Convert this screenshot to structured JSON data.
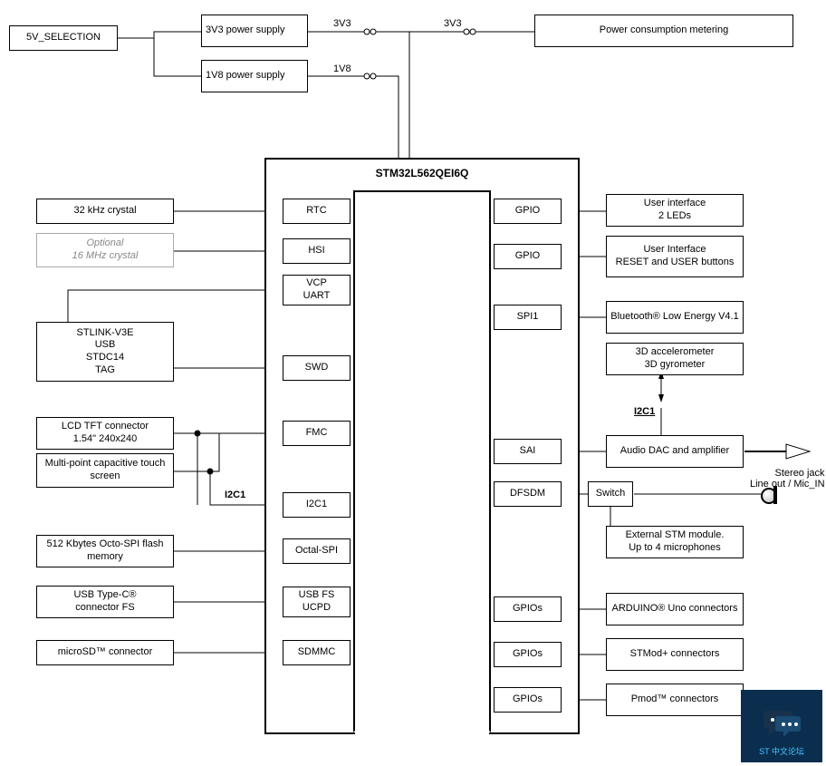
{
  "power": {
    "sel": "5V_SELECTION",
    "ps3v3": "3V3 power supply",
    "ps1v8": "1V8 power supply",
    "lbl3v3": "3V3",
    "lbl1v8": "1V8",
    "meter": "Power consumption metering"
  },
  "mcu": {
    "title": "STM32L562QEI6Q"
  },
  "left_periph": {
    "xtal32k": "32 kHz crystal",
    "xtal16m": "Optional\n16 MHz crystal",
    "stlink": "STLINK-V3E\nUSB\nSTDC14\nTAG",
    "lcd": "LCD TFT connector\n1.54\" 240x240",
    "touch": "Multi-point capacitive touch screen",
    "octo": "512 Kbytes Octo-SPI flash memory",
    "usbc": "USB Type-C®\nconnector FS",
    "usd": "microSD™ connector"
  },
  "left_ports": {
    "rtc": "RTC",
    "hsi": "HSI",
    "vcp": "VCP\nUART",
    "swd": "SWD",
    "fmc": "FMC",
    "i2c1": "I2C1",
    "ospi": "Octal-SPI",
    "usbfs": "USB FS\nUCPD",
    "sdmmc": "SDMMC"
  },
  "right_ports": {
    "gpio1": "GPIO",
    "gpio2": "GPIO",
    "spi1": "SPI1",
    "sai": "SAI",
    "dfsdm": "DFSDM",
    "gpios1": "GPIOs",
    "gpios2": "GPIOs",
    "gpios3": "GPIOs"
  },
  "right_periph": {
    "leds": "User interface\n2 LEDs",
    "buttons": "User Interface\nRESET and USER buttons",
    "ble": "Bluetooth® Low Energy V4.1",
    "imu": "3D accelerometer\n3D gyrometer",
    "dac": "Audio DAC and amplifier",
    "switch": "Switch",
    "mics": "External STM module.\nUp to 4 microphones",
    "arduino": "ARDUINO® Uno connectors",
    "stmod": "STMod+ connectors",
    "pmod": "Pmod™ connectors"
  },
  "bus": {
    "i2c1_left": "I2C1",
    "i2c1_right": "I2C1",
    "jack": "Stereo jack\nLine out / Mic_IN"
  },
  "watermark": "ST 中文论坛"
}
